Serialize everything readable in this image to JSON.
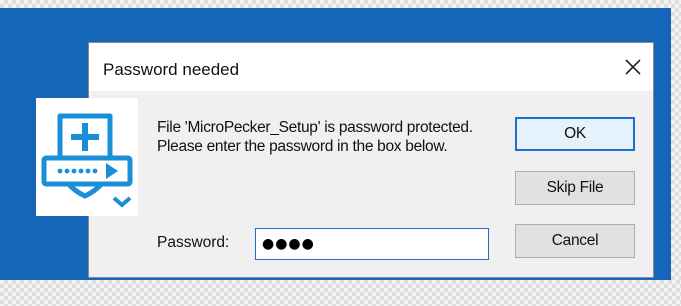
{
  "dialog": {
    "title": "Password needed",
    "close_glyph": "✕",
    "message": "File 'MicroPecker_Setup' is password protected.  Please enter the password in the box below.",
    "password_label": "Password:",
    "password_value": "●●●●",
    "buttons": {
      "ok": "OK",
      "skip": "Skip File",
      "cancel": "Cancel"
    },
    "icon": "password-shield-icon"
  },
  "colors": {
    "desktop": "#1565b8",
    "icon_blue": "#1a8fd8",
    "focus_border": "#1a6fd1"
  }
}
